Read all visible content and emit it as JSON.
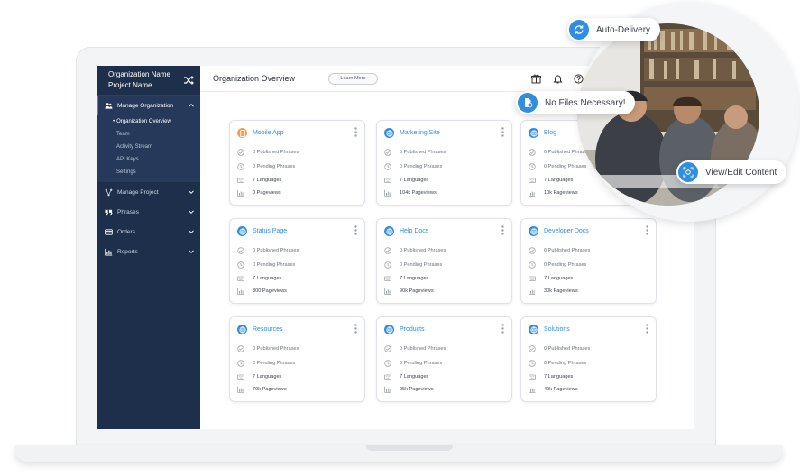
{
  "sidebar": {
    "org_name": "Organization Name",
    "project_name": "Project Name",
    "nav": [
      {
        "label": "Manage Organization",
        "icon": "users-icon"
      },
      {
        "label": "Manage Project",
        "icon": "network-icon"
      },
      {
        "label": "Phrases",
        "icon": "quote-icon"
      },
      {
        "label": "Orders",
        "icon": "card-icon"
      },
      {
        "label": "Reports",
        "icon": "bar-chart-icon"
      }
    ],
    "sub_items": [
      "Organization Overview",
      "Team",
      "Activity Stream",
      "API Keys",
      "Settings"
    ]
  },
  "topbar": {
    "title": "Organization Overview",
    "learn_more": "Learn More"
  },
  "cards": [
    {
      "title": "Mobile App",
      "icon": "mobile-icon",
      "published": "0  Published Phrases",
      "pending": "0  Pending Phrases",
      "languages": "7 Languages",
      "pageviews": "0 Pageviews"
    },
    {
      "title": "Marketing Site",
      "icon": "globe-icon",
      "published": "0  Published Phrases",
      "pending": "0  Pending Phrases",
      "languages": "7 Languages",
      "pageviews": "104k Pageviews"
    },
    {
      "title": "Blog",
      "icon": "globe-icon",
      "published": "0  Published Phrases",
      "pending": "0  Pending Phrases",
      "languages": "7 Languages",
      "pageviews": "10k Pageviews"
    },
    {
      "title": "Status Page",
      "icon": "globe-icon",
      "published": "0  Published Phrases",
      "pending": "0  Pending Phrases",
      "languages": "7 Languages",
      "pageviews": "800 Pageviews"
    },
    {
      "title": "Help Docs",
      "icon": "globe-icon",
      "published": "0  Published Phrases",
      "pending": "0  Pending Phrases",
      "languages": "7 Languages",
      "pageviews": "90k Pageviews"
    },
    {
      "title": "Developer Docs",
      "icon": "globe-icon",
      "published": "0  Published Phrases",
      "pending": "0  Pending Phrases",
      "languages": "7 Languages",
      "pageviews": "30k Pageviews"
    },
    {
      "title": "Resources",
      "icon": "globe-icon",
      "published": "0  Published Phrases",
      "pending": "0  Pending Phrases",
      "languages": "7 Languages",
      "pageviews": "70k Pageviews"
    },
    {
      "title": "Products",
      "icon": "globe-icon",
      "published": "0  Published Phrases",
      "pending": "0  Pending Phrases",
      "languages": "7 Languages",
      "pageviews": "95k Pageviews"
    },
    {
      "title": "Solutions",
      "icon": "globe-icon",
      "published": "0  Published Phrases",
      "pending": "0  Pending Phrases",
      "languages": "7 Languages",
      "pageviews": "40k Pageviews"
    }
  ],
  "callouts": {
    "auto_delivery": "Auto-Delivery",
    "no_files": "No Files Necessary!",
    "view_edit": "View/Edit Content"
  },
  "colors": {
    "sidebar_bg": "#1e2f4c",
    "accent": "#2f8ee0",
    "mobile_icon": "#f0a04b"
  }
}
